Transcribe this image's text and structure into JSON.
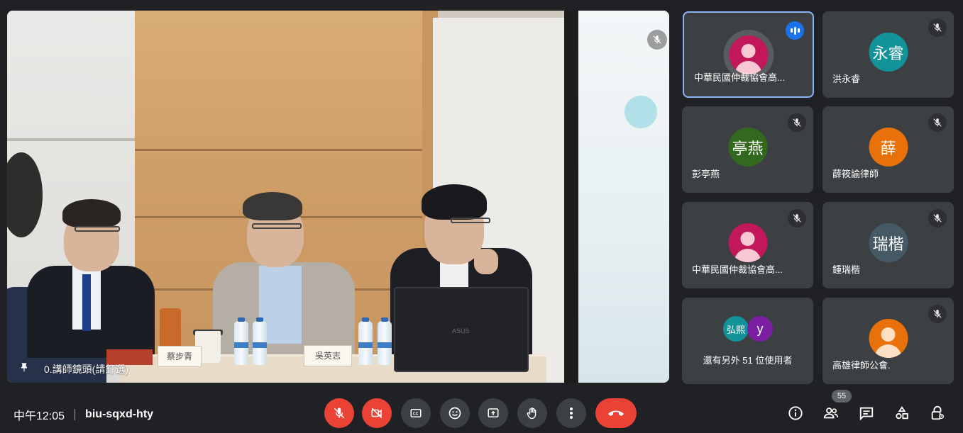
{
  "main_video": {
    "pinned_label": "0.講師鏡頭(請釘選)",
    "nameplates": [
      "蔡步青",
      "吳英志"
    ],
    "laptop_brand": "ASUS"
  },
  "tiles": [
    {
      "name": "中華民國仲裁協會高...",
      "initial": "",
      "avatar_color": "#c2185b",
      "speaking": true
    },
    {
      "name": "洪永睿",
      "initial": "永睿",
      "avatar_color": "#12939a",
      "speaking": false
    },
    {
      "name": "彭亭燕",
      "initial": "亭燕",
      "avatar_color": "#33691e",
      "speaking": false
    },
    {
      "name": "薛筱諭律師",
      "initial": "薛",
      "avatar_color": "#e8710a",
      "speaking": false
    },
    {
      "name": "中華民國仲裁協會高...",
      "initial": "",
      "avatar_color": "#c2185b",
      "speaking": false
    },
    {
      "name": "鍾瑞楷",
      "initial": "瑞楷",
      "avatar_color": "#455a64",
      "speaking": false
    },
    {
      "name": "高雄律師公會.",
      "initial": "",
      "avatar_color": "#e8710a",
      "speaking": false
    }
  ],
  "others": {
    "text": "還有另外 51 位使用者",
    "avatars": [
      {
        "initial": "弘熙",
        "color": "#12939a"
      },
      {
        "initial": "y",
        "color": "#7b1fa2"
      }
    ]
  },
  "bottom_bar": {
    "time": "中午12:05",
    "meeting_code": "biu-sqxd-hty",
    "participant_count": "55"
  },
  "colors": {
    "background": "#202124",
    "tile": "#3c4043",
    "danger": "#ea4335",
    "active_border": "#8ab4f8",
    "speaking": "#1a73e8"
  }
}
